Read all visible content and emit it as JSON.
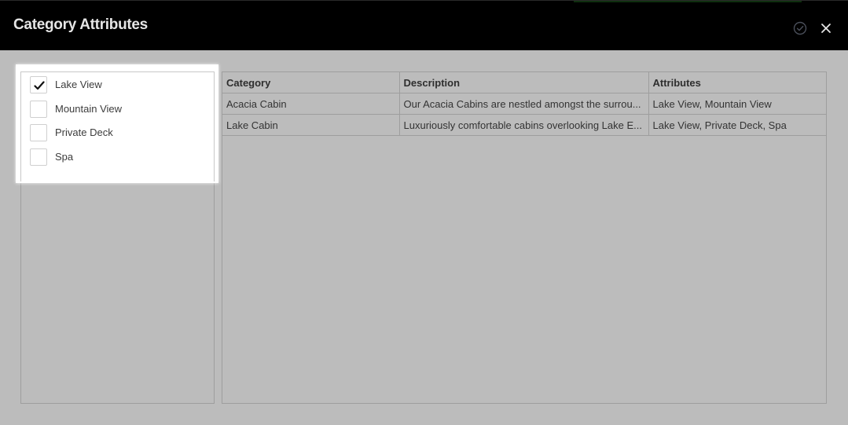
{
  "header": {
    "title": "Category Attributes",
    "confirm_icon": "check-circle-icon",
    "close_icon": "close-icon"
  },
  "attribute_options": [
    {
      "label": "Lake View",
      "checked": true
    },
    {
      "label": "Mountain View",
      "checked": false
    },
    {
      "label": "Private Deck",
      "checked": false
    },
    {
      "label": "Spa",
      "checked": false
    }
  ],
  "table": {
    "columns": [
      "Category",
      "Description",
      "Attributes"
    ],
    "rows": [
      [
        "Acacia Cabin",
        "Our Acacia Cabins are nestled amongst the surrou...",
        "Lake View, Mountain View"
      ],
      [
        "Lake Cabin",
        "Luxuriously comfortable cabins overlooking Lake E...",
        "Lake View, Private Deck, Spa"
      ]
    ]
  },
  "colors": {
    "header_bg": "#000000",
    "background": "#bcbcbc",
    "popup_bg": "#ffffff",
    "grid_line": "#9e9e9e"
  }
}
